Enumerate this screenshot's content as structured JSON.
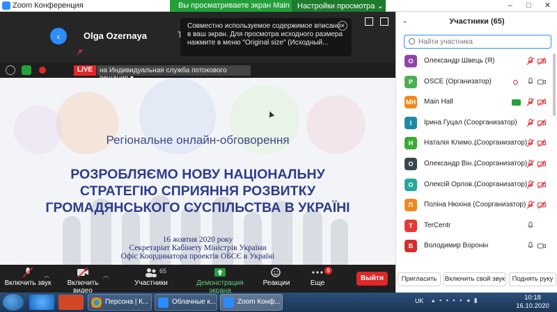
{
  "window": {
    "title": "Zoom Конференция",
    "share_banner": "Вы просматриваете экран Main Hall",
    "view_options": "Настройки просмотра ⌄",
    "controls": [
      "–",
      "□",
      "✕"
    ]
  },
  "speaker": {
    "name": "Olga Ozernaya",
    "fragment": "T"
  },
  "notice": {
    "text": "Совместно используемое содержимое вписано в ваш экран. Для просмотра исходного размера нажмите в меню \"Original size\" (Исходный..."
  },
  "live": {
    "badge": "LIVE",
    "text": "на Индивидуальная служба потокового вещания ▾"
  },
  "slide": {
    "subtitle": "Регіональне онлайн-обговорення",
    "title_lines": [
      "РОЗРОБЛЯЄМО НОВУ НАЦІОНАЛЬНУ",
      "СТРАТЕГІЮ СПРИЯННЯ РОЗВИТКУ",
      "ГРОМАДЯНСЬКОГО СУСПІЛЬСТВА В УКРАЇНІ"
    ],
    "date": "16 жовтня 2020 року",
    "org1": "Секретаріат Кабінету Міністрів України",
    "org2": "Офіс Координатора проектів ОБСЄ в Україні"
  },
  "toolbar": {
    "mute": "Включить звук",
    "video": "Включить видео",
    "participants": "Участники",
    "participants_count": "65",
    "share": "Демонстрация экрана",
    "reactions": "Реакции",
    "more": "Еще",
    "more_badge": "9",
    "end": "Выйти"
  },
  "panel": {
    "title": "Участники (65)",
    "search_placeholder": "Найти участника",
    "participants": [
      {
        "initials": "О",
        "name": "Олександр Швець (Я)",
        "role": "",
        "color": "#8e44ad"
      },
      {
        "initials": "P",
        "name": "OSCE (Организатор)",
        "role": "",
        "color": "#4caf50"
      },
      {
        "initials": "MH",
        "name": "Main Hall",
        "role": "",
        "color": "#f0881e"
      },
      {
        "initials": "I",
        "name": "Ірина Гуцал (Соорганизатор)",
        "role": "",
        "color": "#1e88a8"
      },
      {
        "initials": "Н",
        "name": "Наталія Климо...",
        "role": "(Соорганизатор)",
        "color": "#3aaa35"
      },
      {
        "initials": "О",
        "name": "Олександр Він...",
        "role": "(Соорганизатор)",
        "color": "#37474f"
      },
      {
        "initials": "О",
        "name": "Олексій Орлов...",
        "role": "(Соорганизатор)",
        "color": "#26a69a"
      },
      {
        "initials": "П",
        "name": "Поліна Нюхіна (Соорганизатор)",
        "role": "",
        "color": "#f0881e"
      },
      {
        "initials": "T",
        "name": "TerCentr",
        "role": "",
        "color": "#e53935"
      },
      {
        "initials": "В",
        "name": "Володимир Воронін",
        "role": "",
        "color": "#d32f2f"
      }
    ],
    "footer": {
      "invite": "Пригласить",
      "unmute_me": "Включить свой звук",
      "raise_hand": "Поднять руку"
    }
  },
  "taskbar": {
    "tasks": [
      "Персона | К...",
      "Облачные к...",
      "Zoom Конф..."
    ],
    "lang": "UK",
    "time": "10:18",
    "date": "16.10.2020"
  },
  "colors": {
    "accent": "#2d8cff",
    "banner_green": "#23a03a",
    "live_red": "#e02828"
  }
}
